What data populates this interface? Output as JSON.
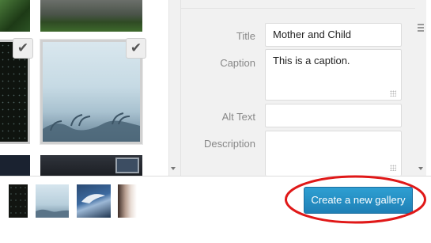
{
  "attachment_details": {
    "title": {
      "label": "Title",
      "value": "Mother and Child"
    },
    "caption": {
      "label": "Caption",
      "value": "This is a caption."
    },
    "alt_text": {
      "label": "Alt Text",
      "value": ""
    },
    "description": {
      "label": "Description",
      "value": ""
    }
  },
  "toolbar": {
    "create_gallery_label": "Create a new gallery"
  },
  "icons": {
    "checkmark": "✔",
    "scroll_grip": "grip-lines-icon"
  },
  "colors": {
    "button_blue": "#2a91c8",
    "highlight_red": "#e01818"
  }
}
